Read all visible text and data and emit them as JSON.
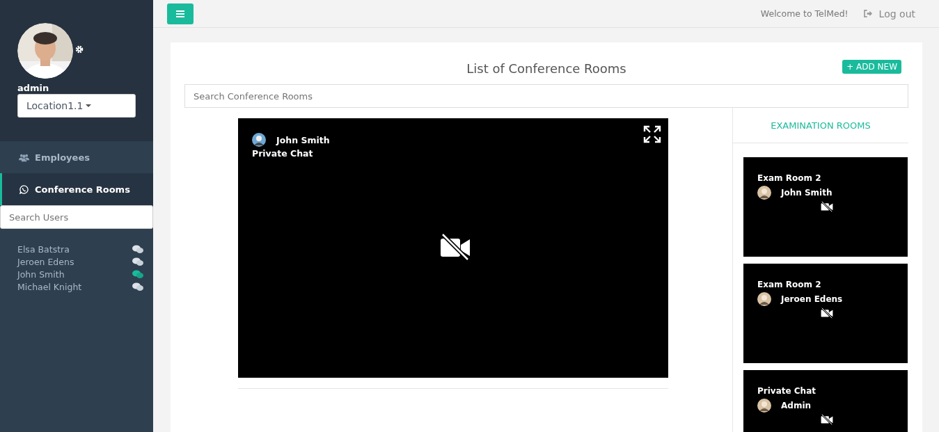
{
  "sidebar": {
    "user": {
      "name": "admin",
      "location": "Location1.1"
    },
    "nav": [
      {
        "label": "Employees",
        "selected": false
      },
      {
        "label": "Conference Rooms",
        "selected": true
      }
    ],
    "search": {
      "placeholder": "Search Users"
    },
    "users": [
      {
        "name": "Elsa Batstra",
        "online": false
      },
      {
        "name": "Jeroen Edens",
        "online": false
      },
      {
        "name": "John Smith",
        "online": true
      },
      {
        "name": "Michael Knight",
        "online": false
      }
    ]
  },
  "header": {
    "welcome": "Welcome to TelMed!",
    "logout": "Log out"
  },
  "panel": {
    "title": "List of Conference Rooms",
    "add_button": "+ ADD NEW",
    "search": {
      "placeholder": "Search Conference Rooms"
    },
    "main_video": {
      "participant": "John Smith",
      "room": "Private Chat"
    },
    "rooms_heading": "EXAMINATION ROOMS",
    "rooms": [
      {
        "room": "Exam Room 2",
        "participant": "John Smith"
      },
      {
        "room": "Exam Room 2",
        "participant": "Jeroen Edens"
      },
      {
        "room": "Private Chat",
        "participant": "Admin"
      }
    ]
  }
}
